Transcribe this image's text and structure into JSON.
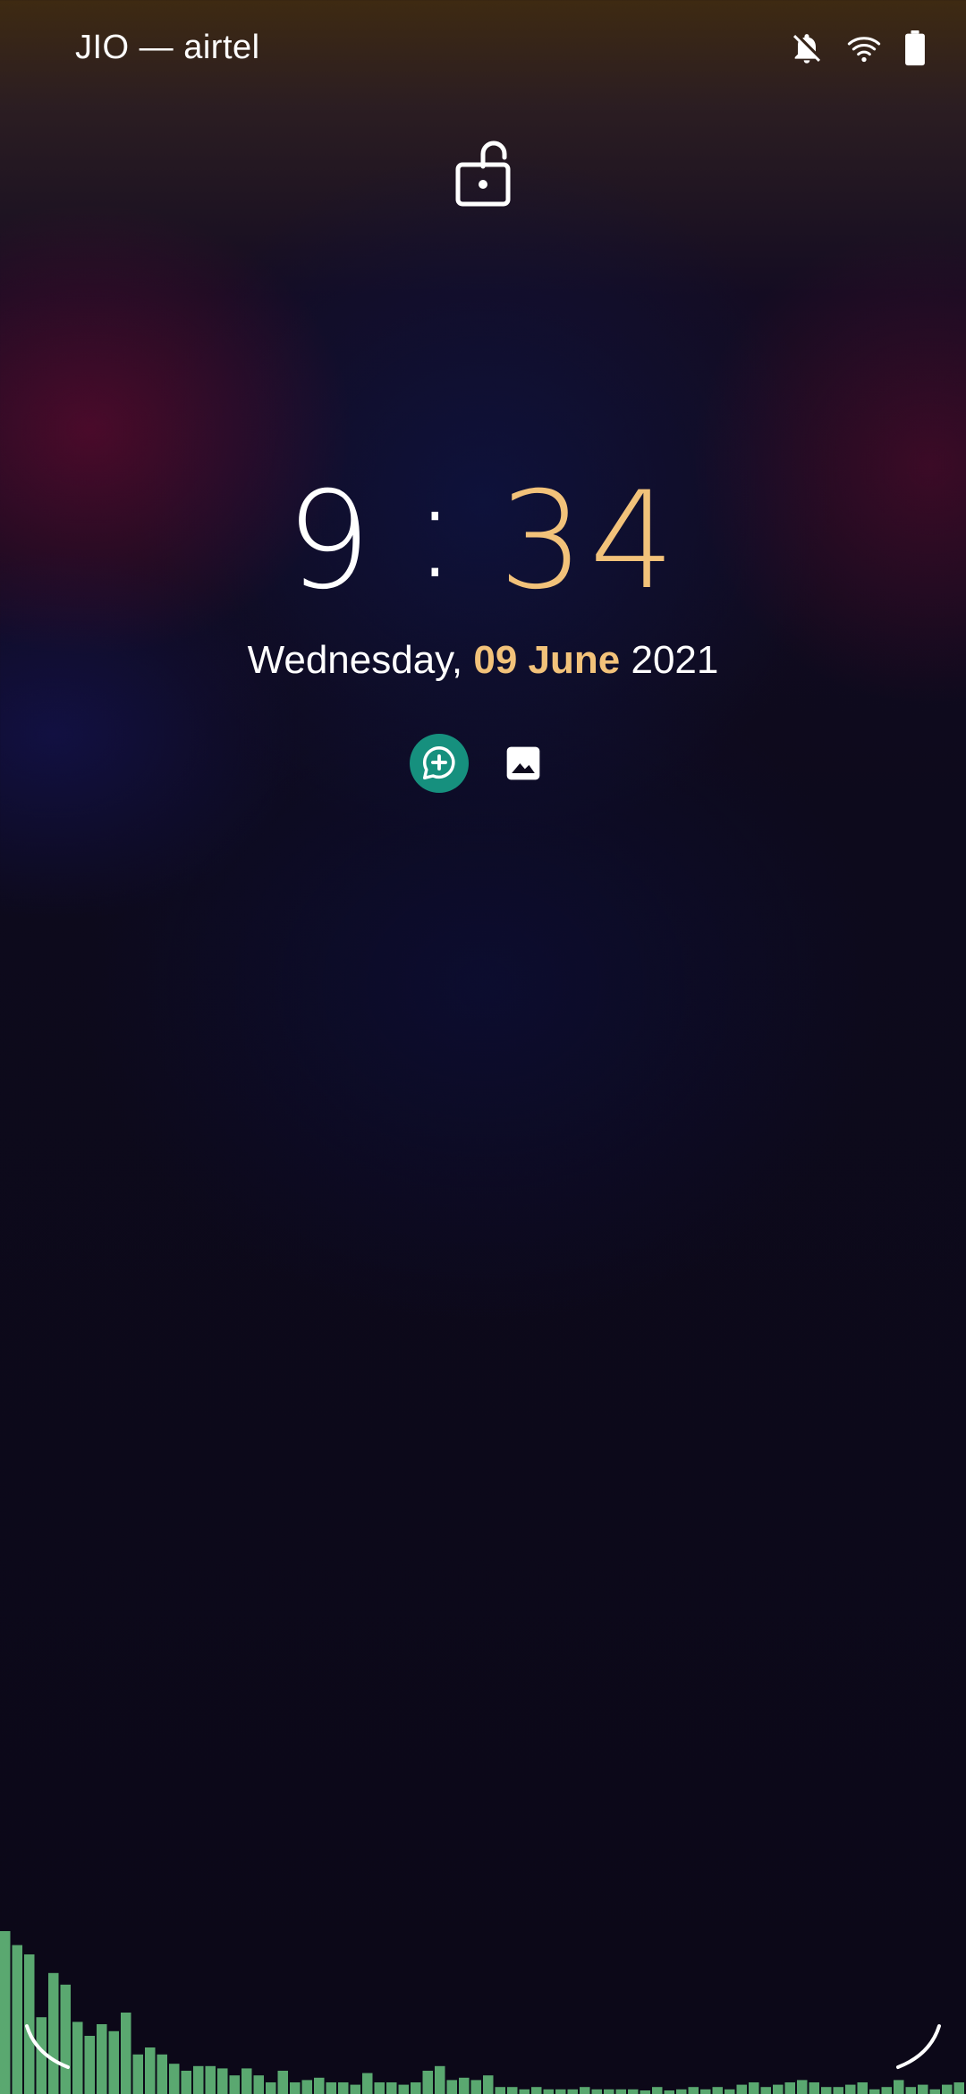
{
  "status_bar": {
    "carrier": "JIO — airtel",
    "icons": [
      "notifications-off-icon",
      "wifi-icon",
      "battery-icon"
    ]
  },
  "lock_screen": {
    "lock_icon": "unlocked-padlock-icon",
    "clock": {
      "hours": "9",
      "separator": ":",
      "minutes": "34"
    },
    "date": {
      "weekday": "Wednesday,",
      "day_month": "09 June",
      "year": "2021"
    },
    "shortcuts": [
      "add-chat-icon",
      "gallery-icon"
    ]
  },
  "colors": {
    "accent": "#f2c27a",
    "shortcut_bg": "#16907e",
    "visualizer_bar": "#5aa870"
  },
  "visualizer_levels": [
    0.7,
    0.64,
    0.6,
    0.33,
    0.52,
    0.47,
    0.31,
    0.25,
    0.3,
    0.27,
    0.35,
    0.17,
    0.2,
    0.17,
    0.13,
    0.1,
    0.12,
    0.12,
    0.11,
    0.08,
    0.11,
    0.08,
    0.05,
    0.1,
    0.05,
    0.06,
    0.07,
    0.05,
    0.05,
    0.04,
    0.09,
    0.05,
    0.05,
    0.04,
    0.05,
    0.1,
    0.12,
    0.06,
    0.07,
    0.06,
    0.08,
    0.03,
    0.03,
    0.02,
    0.03,
    0.02,
    0.02,
    0.02,
    0.03,
    0.02,
    0.02,
    0.02,
    0.02,
    0.01,
    0.03,
    0.01,
    0.02,
    0.03,
    0.02,
    0.03,
    0.02,
    0.04,
    0.05,
    0.03,
    0.04,
    0.05,
    0.06,
    0.05,
    0.03,
    0.03,
    0.04,
    0.05,
    0.02,
    0.03,
    0.06,
    0.03,
    0.04,
    0.02,
    0.04,
    0.05
  ]
}
